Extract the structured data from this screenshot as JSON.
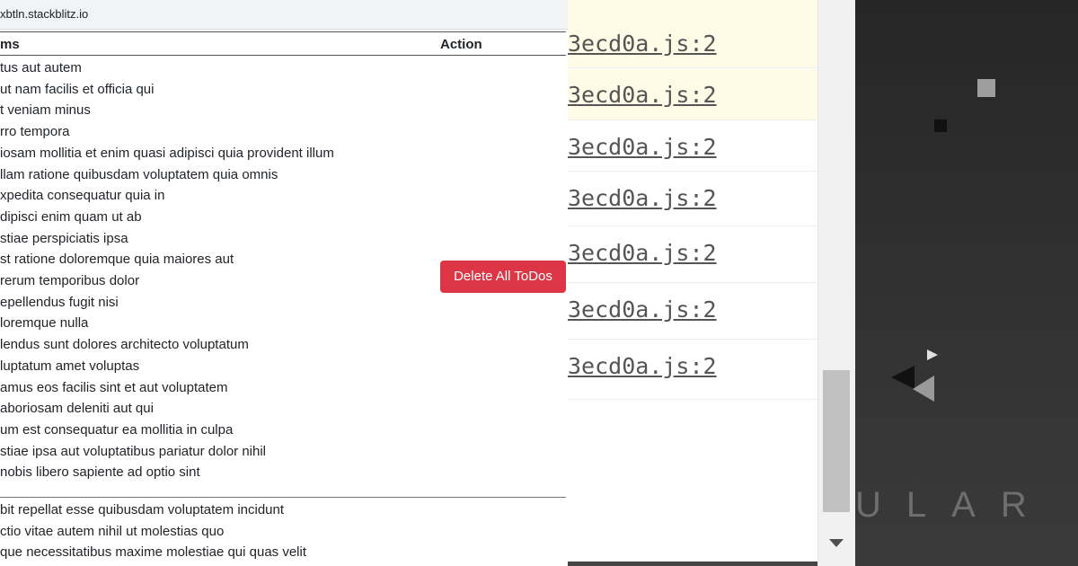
{
  "browser": {
    "url": "xbtln.stackblitz.io"
  },
  "table": {
    "col_items": "ms",
    "col_action": "Action",
    "delete_label": "Delete All ToDos"
  },
  "todos": [
    "tus aut autem",
    "ut nam facilis et officia qui",
    "t veniam minus",
    "rro tempora",
    "iosam mollitia et enim quasi adipisci quia provident illum",
    "llam ratione quibusdam voluptatem quia omnis",
    "xpedita consequatur quia in",
    "dipisci enim quam ut ab",
    "stiae perspiciatis ipsa",
    "st ratione doloremque quia maiores aut",
    "rerum temporibus dolor",
    "epellendus fugit nisi",
    "loremque nulla",
    "lendus sunt dolores architecto voluptatum",
    "luptatum amet voluptas",
    "amus eos facilis sint et aut voluptatem",
    "aboriosam deleniti aut qui",
    "um est consequatur ea mollitia in culpa",
    "stiae ipsa aut voluptatibus pariatur dolor nihil",
    " nobis libero sapiente ad optio sint"
  ],
  "todos_next": [
    "bit repellat esse quibusdam voluptatem incidunt",
    "ctio vitae autem nihil ut molestias quo",
    "que necessitatibus maxime molestiae qui quas velit"
  ],
  "console": {
    "links": [
      "3ecd0a.js:2",
      "3ecd0a.js:2",
      "3ecd0a.js:2",
      "3ecd0a.js:2",
      "3ecd0a.js:2",
      "3ecd0a.js:2",
      "3ecd0a.js:2"
    ],
    "warn_rows": [
      0,
      1
    ]
  },
  "scrollbar": {
    "down_icon": "triangle-down-icon"
  },
  "brand": {
    "text": "ULAR",
    "background_color": "#2b2b2b"
  },
  "colors": {
    "danger": "#dc3545",
    "warn_bg": "#fffbe6",
    "console_link": "#555555"
  }
}
